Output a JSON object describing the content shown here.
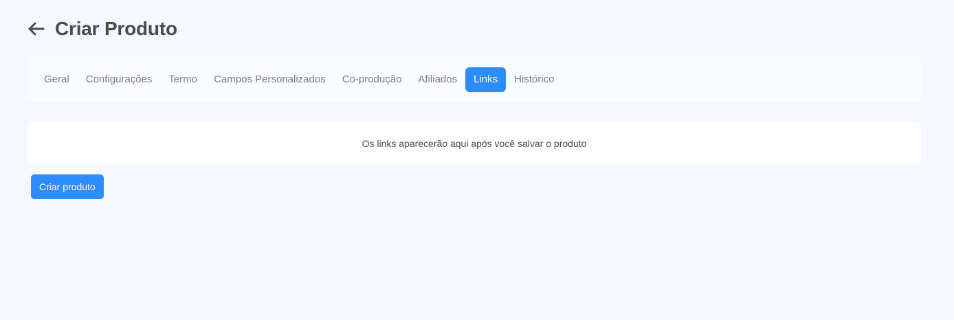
{
  "header": {
    "back_icon": "arrow-left-icon",
    "title": "Criar Produto"
  },
  "tabs": [
    {
      "label": "Geral",
      "active": false
    },
    {
      "label": "Configurações",
      "active": false
    },
    {
      "label": "Termo",
      "active": false
    },
    {
      "label": "Campos Personalizados",
      "active": false
    },
    {
      "label": "Co-produção",
      "active": false
    },
    {
      "label": "Afiliados",
      "active": false
    },
    {
      "label": "Links",
      "active": true
    },
    {
      "label": "Histórico",
      "active": false
    }
  ],
  "links_panel": {
    "message": "Os links aparecerão aqui após você salvar o produto"
  },
  "actions": {
    "create_label": "Criar produto"
  },
  "colors": {
    "background": "#f5f8ff",
    "accent": "#2d8cff",
    "title_text": "#4b4b4b",
    "tab_text": "#7c7c7c"
  }
}
